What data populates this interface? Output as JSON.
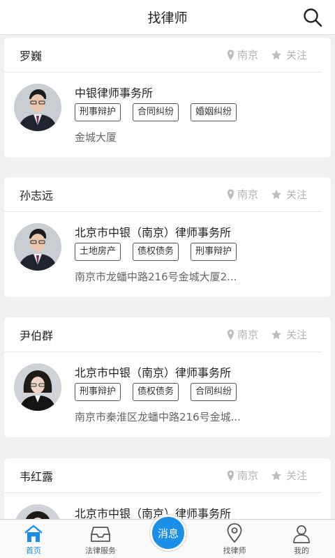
{
  "header": {
    "title": "找律师",
    "search_icon": "search-icon"
  },
  "lawyers": [
    {
      "name": "罗巍",
      "city": "南京",
      "follow_label": "关注",
      "firm": "中银律师事务所",
      "tags": [
        "刑事辩护",
        "合同纠纷",
        "婚姻纠纷"
      ],
      "address": "金城大厦",
      "avatar_gender": "male"
    },
    {
      "name": "孙志远",
      "city": "南京",
      "follow_label": "关注",
      "firm": "北京市中银（南京）律师事务所",
      "tags": [
        "土地房产",
        "债权债务",
        "刑事辩护"
      ],
      "address": "南京市龙蟠中路216号金城大厦2...",
      "avatar_gender": "male"
    },
    {
      "name": "尹伯群",
      "city": "南京",
      "follow_label": "关注",
      "firm": "北京市中银（南京）律师事务所",
      "tags": [
        "刑事辩护",
        "债权债务",
        "合同纠纷"
      ],
      "address": "南京市秦淮区龙蟠中路216号金城...",
      "avatar_gender": "female"
    },
    {
      "name": "韦红露",
      "city": "南京",
      "follow_label": "关注",
      "firm": "北京市中银（南京）律师事务所",
      "tags": [],
      "address": "",
      "avatar_gender": "female"
    }
  ],
  "tabbar": {
    "tabs": [
      {
        "label": "首页",
        "icon": "home-icon",
        "active": true
      },
      {
        "label": "法律服务",
        "icon": "inbox-icon",
        "active": false
      },
      {
        "label": "",
        "icon": "",
        "active": false
      },
      {
        "label": "找律师",
        "icon": "location-pin-icon",
        "active": false
      },
      {
        "label": "我的",
        "icon": "user-icon",
        "active": false
      }
    ],
    "center_button_label": "消息"
  },
  "colors": {
    "accent": "#1c8fe8",
    "card_bg": "#ffffff",
    "page_bg": "#f1f1f1",
    "muted": "#b4b4b4"
  }
}
